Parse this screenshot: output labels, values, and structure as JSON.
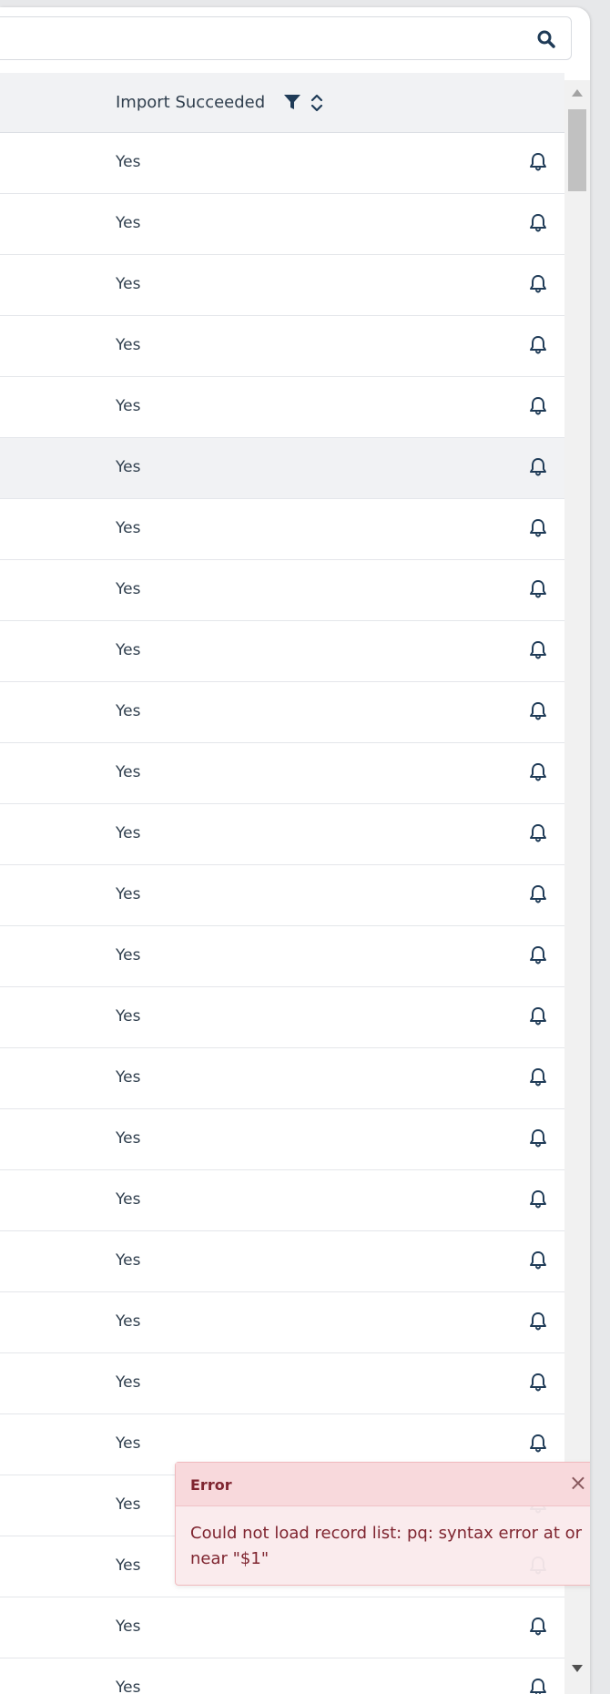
{
  "search": {
    "icon": "search-icon"
  },
  "table": {
    "column_header": "Import Succeeded",
    "rows": [
      "Yes",
      "Yes",
      "Yes",
      "Yes",
      "Yes",
      "Yes",
      "Yes",
      "Yes",
      "Yes",
      "Yes",
      "Yes",
      "Yes",
      "Yes",
      "Yes",
      "Yes",
      "Yes",
      "Yes",
      "Yes",
      "Yes",
      "Yes",
      "Yes",
      "Yes",
      "Yes",
      "Yes",
      "Yes",
      "Yes"
    ],
    "hovered_row_index": 5
  },
  "toast": {
    "title": "Error",
    "close": "×",
    "message": "Could not load record list: pq: syntax error at or near \"$1\""
  },
  "colors": {
    "text": "#2f3e4d",
    "icon": "#1f3b57",
    "error_text": "#7f2530",
    "error_bg": "#faeaec"
  }
}
